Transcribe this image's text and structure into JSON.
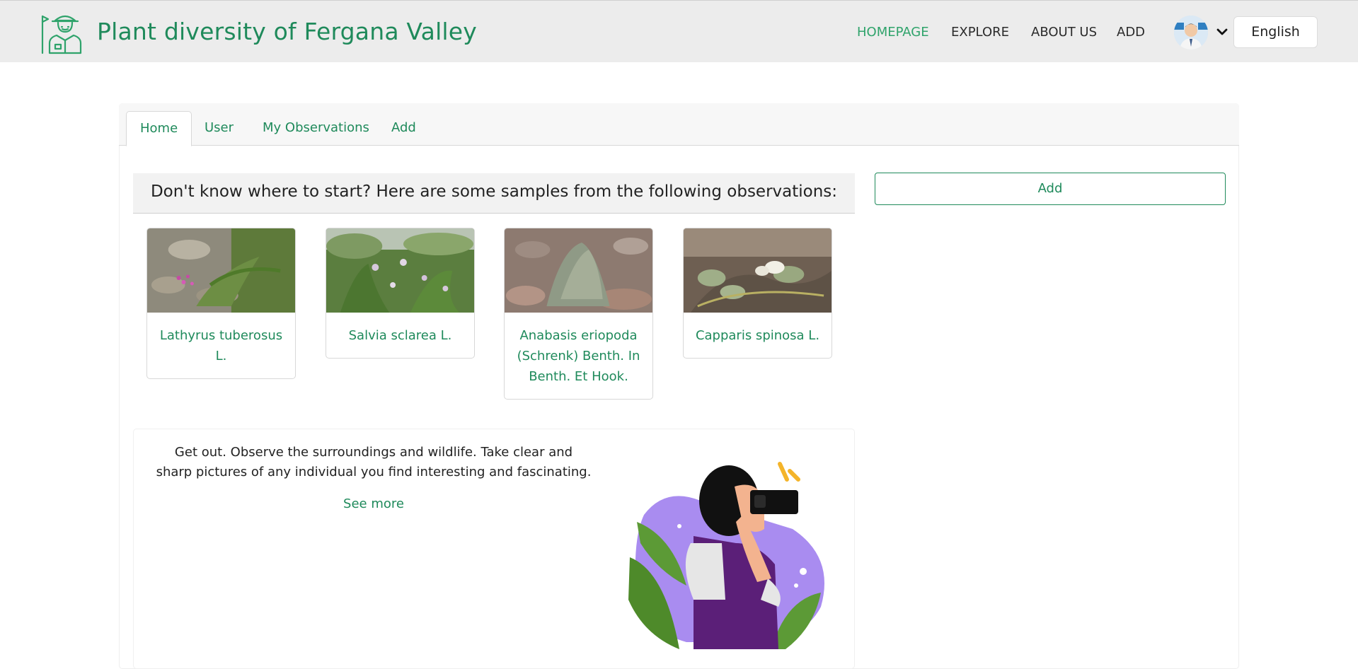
{
  "header": {
    "site_title": "Plant diversity of Fergana Valley",
    "nav": [
      "HOMEPAGE",
      "EXPLORE",
      "ABOUT US",
      "ADD"
    ],
    "active_nav": "HOMEPAGE",
    "language": "English"
  },
  "tabs": [
    "Home",
    "User",
    "My Observations",
    "Add"
  ],
  "active_tab": "Home",
  "samples_heading": "Don't know where to start? Here are some samples from the following observations:",
  "add_button_label": "Add",
  "samples": [
    {
      "name": "Lathyrus tuberosus L."
    },
    {
      "name": "Salvia sclarea L."
    },
    {
      "name": "Anabasis eriopoda (Schrenk) Benth. In Benth. Et Hook."
    },
    {
      "name": "Capparis spinosa L."
    }
  ],
  "info": {
    "text": "Get out. Observe the surroundings and wildlife. Take clear and sharp pictures of any individual you find interesting and fascinating.",
    "see_more": "See more"
  },
  "colors": {
    "brand_green": "#1f8a5b",
    "active_nav": "#2fa36b",
    "header_bg": "#ececec"
  }
}
